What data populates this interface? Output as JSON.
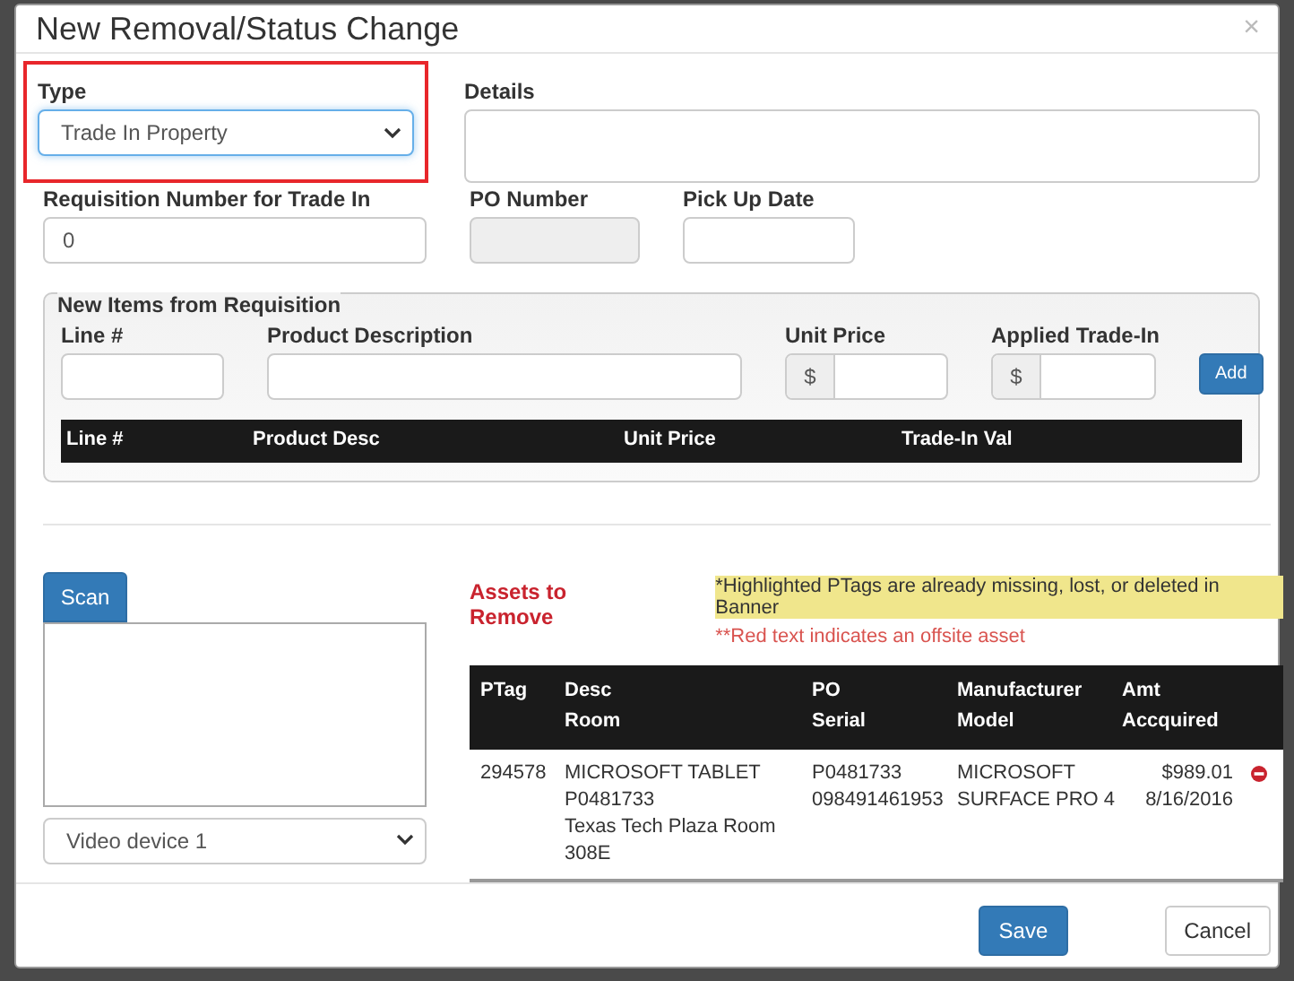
{
  "dialog": {
    "title": "New Removal/Status Change",
    "close": "×"
  },
  "type_field": {
    "label": "Type",
    "value": "Trade In Property",
    "highlighted": true
  },
  "details_field": {
    "label": "Details"
  },
  "requisition_field": {
    "label": "Requisition Number for Trade In",
    "value": "0"
  },
  "po_field": {
    "label": "PO Number",
    "disabled": true
  },
  "pickup_field": {
    "label": "Pick Up Date"
  },
  "new_items": {
    "legend": "New Items from Requisition",
    "fields": [
      {
        "label": "Line #",
        "kind": "text"
      },
      {
        "label": "Product Description",
        "kind": "text"
      },
      {
        "label": "Unit Price",
        "kind": "money",
        "addon": "$"
      },
      {
        "label": "Applied Trade-In",
        "kind": "money",
        "addon": "$"
      }
    ],
    "add_button": "Add",
    "columns": [
      "Line #",
      "Product Desc",
      "Unit Price",
      "Trade-In Val"
    ]
  },
  "scanner": {
    "button": "Scan",
    "device": "Video device 1"
  },
  "assets": {
    "title": "Assets to Remove",
    "note_highlight": "*Highlighted PTags are already missing, lost, or deleted in Banner",
    "note_red": "**Red text indicates an offsite asset",
    "columns": [
      [
        "PTag"
      ],
      [
        "Desc",
        "Room"
      ],
      [
        "PO",
        "Serial"
      ],
      [
        "Manufacturer",
        "Model"
      ],
      [
        "Amt",
        "Accquired"
      ]
    ],
    "rows": [
      {
        "ptag": "294578",
        "desc": [
          "MICROSOFT TABLET",
          "P0481733",
          "Texas Tech Plaza Room 308E"
        ],
        "po": [
          "P0481733",
          "098491461953"
        ],
        "manufacturer": [
          "MICROSOFT",
          "SURFACE PRO 4"
        ],
        "amount": [
          "$989.01",
          "8/16/2016"
        ],
        "highlighted": false,
        "offsite": false
      }
    ]
  },
  "footer": {
    "buttons": [
      {
        "label": "Save",
        "kind": "primary"
      },
      {
        "label": "Cancel",
        "kind": "default"
      }
    ]
  }
}
